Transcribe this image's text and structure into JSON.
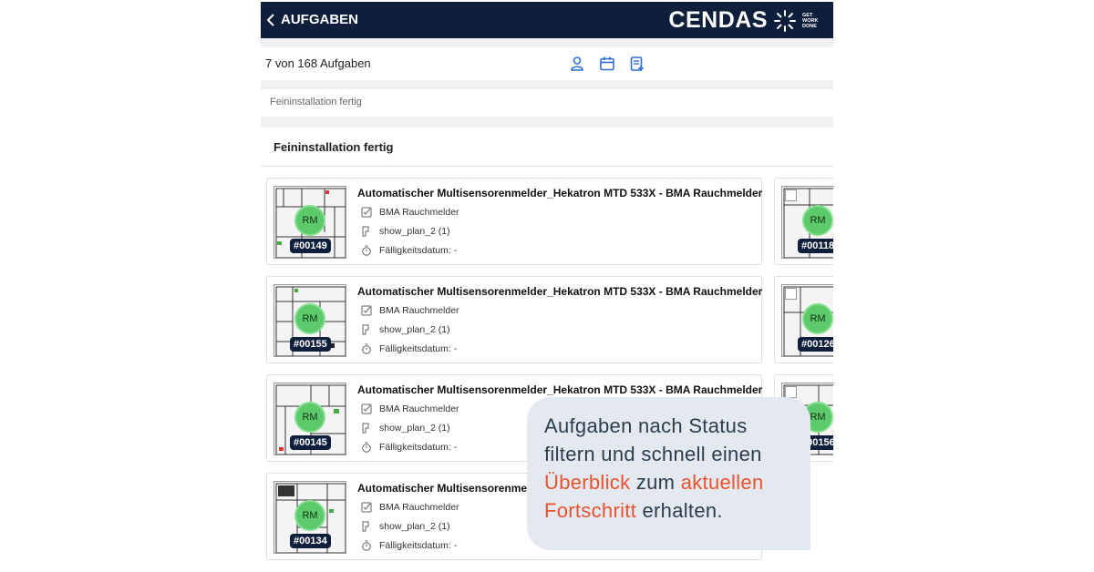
{
  "header": {
    "back_label": "AUFGABEN",
    "logo_text": "CENDAS",
    "logo_tagline": [
      "GET",
      "WORK",
      "DONE"
    ]
  },
  "toolbar": {
    "count_label": "7 von 168 Aufgaben",
    "icons": [
      "user-icon",
      "calendar-icon",
      "add-list-icon"
    ]
  },
  "filter": {
    "label": "Feininstallation fertig"
  },
  "section": {
    "title": "Feininstallation fertig"
  },
  "tasks": [
    {
      "id": "#00149",
      "marker": "RM",
      "title": "Automatischer Multisensorenmelder_Hekatron MTD 533X - BMA Rauchmelder",
      "category": "BMA Rauchmelder",
      "plan": "show_plan_2 (1)",
      "due": "Fälligkeitsdatum: -"
    },
    {
      "id": "#00155",
      "marker": "RM",
      "title": "Automatischer Multisensorenmelder_Hekatron MTD 533X - BMA Rauchmelder",
      "category": "BMA Rauchmelder",
      "plan": "show_plan_2 (1)",
      "due": "Fälligkeitsdatum: -"
    },
    {
      "id": "#00145",
      "marker": "RM",
      "title": "Automatischer Multisensorenmelder_Hekatron MTD 533X - BMA Rauchmelder",
      "category": "BMA Rauchmelder",
      "plan": "show_plan_2 (1)",
      "due": "Fälligkeitsdatum: -"
    },
    {
      "id": "#00134",
      "marker": "RM",
      "title": "Automatischer Multisensorenmelder",
      "category": "BMA Rauchmelder",
      "plan": "show_plan_2 (1)",
      "due": "Fälligkeitsdatum: -"
    }
  ],
  "side_tasks": [
    {
      "id": "#00118",
      "marker": "RM"
    },
    {
      "id": "#00126",
      "marker": "RM"
    },
    {
      "id": "#00156",
      "marker": "RM"
    }
  ],
  "callout": {
    "line1": "Aufgaben nach Status",
    "line2": "filtern und schnell einen",
    "line3_accent1": "Überblick",
    "line3_mid": "zum",
    "line3_accent2": "aktuellen",
    "line4_accent": "Fortschritt",
    "line4_rest": "erhalten."
  },
  "colors": {
    "header_bg": "#0f1e3a",
    "accent_blue": "#2f6fd1",
    "marker_green": "#5cc96a",
    "callout_accent": "#e8522f",
    "callout_bg": "#e4e9ef"
  }
}
